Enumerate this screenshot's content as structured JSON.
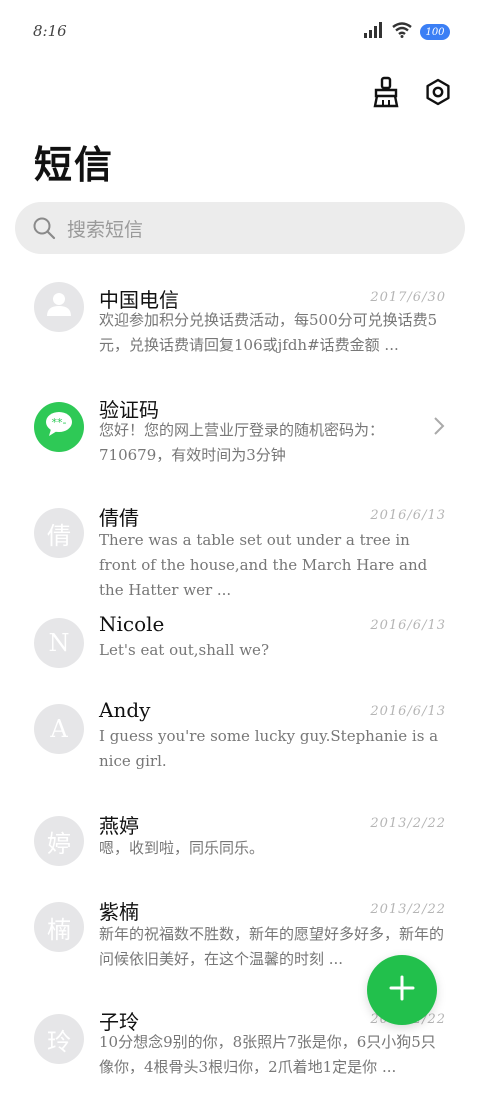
{
  "status_bar": {
    "time": "8:16",
    "battery": "100"
  },
  "title": "短信",
  "search": {
    "placeholder": "搜索短信"
  },
  "toolbar": {
    "clean_icon": "broom-icon",
    "settings_icon": "gear-icon"
  },
  "messages": [
    {
      "name": "中国电信",
      "date": "2017/6/30",
      "avatar": "person-icon",
      "preview": "欢迎参加积分兑换话费活动，每500分可兑换话费5元，兑换话费请回复106或jfdh#话费金额 ..."
    },
    {
      "name": "验证码",
      "date": "",
      "avatar": "chat-bubble-icon",
      "preview": "您好！您的网上营业厅登录的随机密码为：710679，有效时间为3分钟"
    },
    {
      "name": "倩倩",
      "date": "2016/6/13",
      "avatar": "倩",
      "preview": "There was a table set out under a tree in front of the house,and the March Hare and the Hatter wer ..."
    },
    {
      "name": "Nicole",
      "date": "2016/6/13",
      "avatar": "N",
      "preview": "Let's eat out,shall we?"
    },
    {
      "name": "Andy",
      "date": "2016/6/13",
      "avatar": "A",
      "preview": "I guess you're some lucky guy.Stephanie is a nice girl."
    },
    {
      "name": "燕婷",
      "date": "2013/2/22",
      "avatar": "婷",
      "preview": "嗯，收到啦，同乐同乐。"
    },
    {
      "name": "紫楠",
      "date": "2013/2/22",
      "avatar": "楠",
      "preview": "新年的祝福数不胜数，新年的愿望好多好多，新年的问候依旧美好，在这个温馨的时刻 ..."
    },
    {
      "name": "子玲",
      "date": "2013/2/22",
      "avatar": "玲",
      "preview": "10分想念9别的你，8张照片7张是你，6只小狗5只像你，4根骨头3根归你，2爪着地1定是你 ..."
    }
  ],
  "fab": {
    "icon": "plus-icon"
  },
  "colors": {
    "accent": "#22c04c",
    "battery": "#3b7ff5",
    "avatar_bg": "#e6e6e8"
  }
}
